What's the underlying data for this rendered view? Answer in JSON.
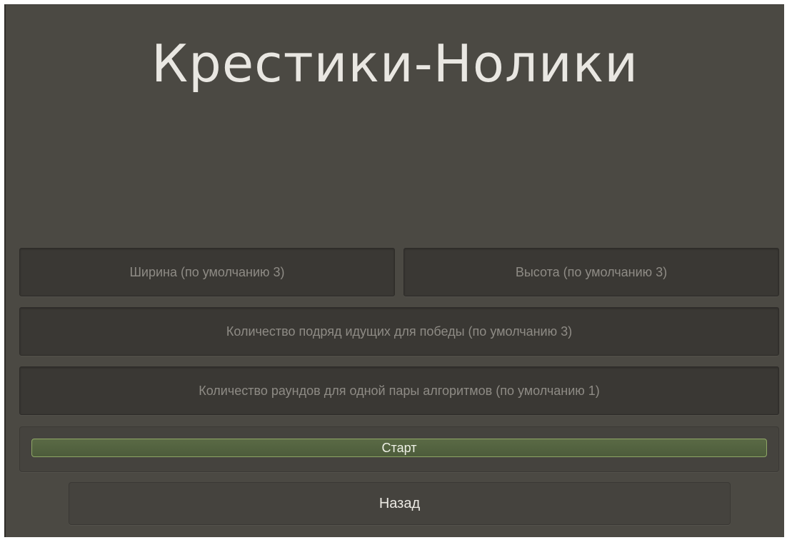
{
  "title": "Крестики-Нолики",
  "fields": {
    "width": {
      "placeholder": "Ширина (по умолчанию 3)",
      "value": ""
    },
    "height": {
      "placeholder": "Высота (по умолчанию 3)",
      "value": ""
    },
    "win_length": {
      "placeholder": "Количество подряд идущих для победы (по умолчанию 3)",
      "value": ""
    },
    "rounds": {
      "placeholder": "Количество раундов для одной пары алгоритмов (по умолчанию 1)",
      "value": ""
    }
  },
  "buttons": {
    "start": "Старт",
    "back": "Назад"
  },
  "colors": {
    "background": "#4b4943",
    "field": "#3a3834",
    "start_accent": "#8fa766",
    "title_text": "#e9e7e2"
  }
}
